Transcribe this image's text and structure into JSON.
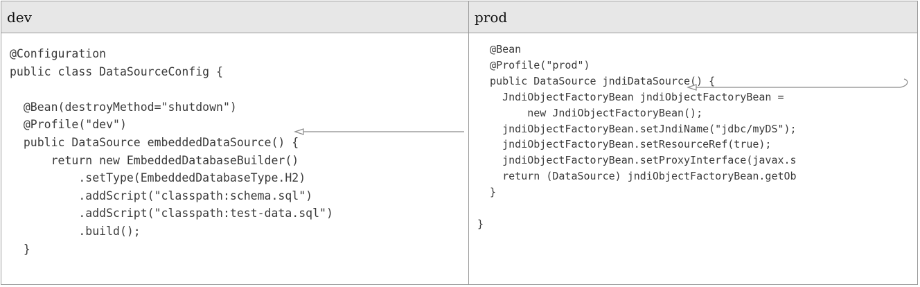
{
  "columns": {
    "dev": {
      "header": "dev",
      "code_lines": [
        "@Configuration",
        "public class DataSourceConfig {",
        "",
        "  @Bean(destroyMethod=\"shutdown\")",
        "  @Profile(\"dev\")",
        "  public DataSource embeddedDataSource() {",
        "      return new EmbeddedDatabaseBuilder()",
        "          .setType(EmbeddedDatabaseType.H2)",
        "          .addScript(\"classpath:schema.sql\")",
        "          .addScript(\"classpath:test-data.sql\")",
        "          .build();",
        "  }"
      ]
    },
    "prod": {
      "header": "prod",
      "code_lines": [
        "  @Bean",
        "  @Profile(\"prod\")",
        "  public DataSource jndiDataSource() {",
        "    JndiObjectFactoryBean jndiObjectFactoryBean =",
        "        new JndiObjectFactoryBean();",
        "    jndiObjectFactoryBean.setJndiName(\"jdbc/myDS\");",
        "    jndiObjectFactoryBean.setResourceRef(true);",
        "    jndiObjectFactoryBean.setProxyInterface(javax.s",
        "    return (DataSource) jndiObjectFactoryBean.getOb",
        "  }",
        "",
        "}"
      ]
    }
  },
  "colors": {
    "header_bg": "#e7e7e7",
    "border": "#9a9a9a",
    "code_text": "#3a3a3a",
    "arrow": "#8a8a8a"
  }
}
